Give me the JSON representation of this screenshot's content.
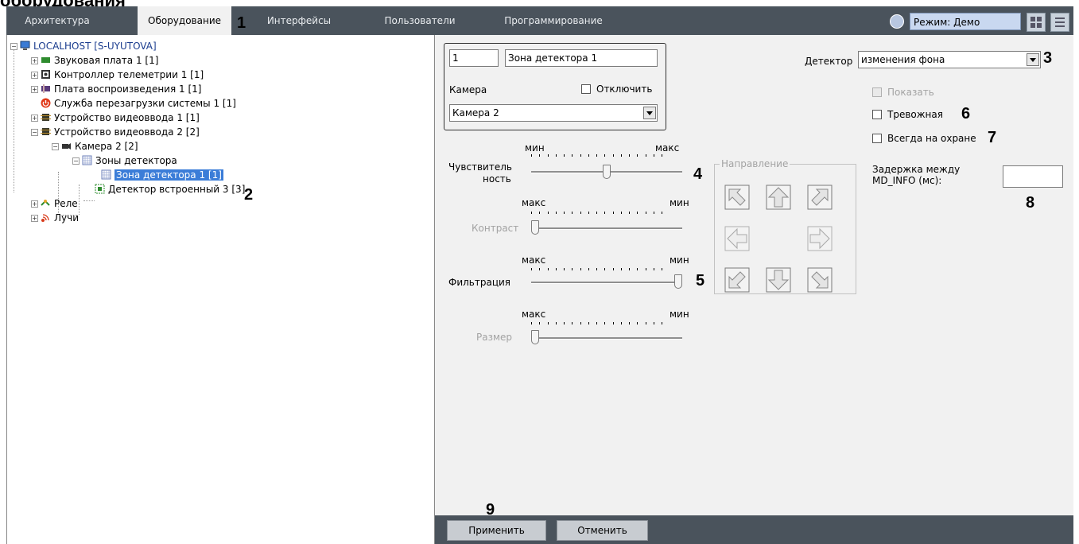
{
  "page_heading_fragment": "оборудования",
  "tabs": [
    "Архитектура",
    "Оборудование",
    "Интерфейсы",
    "Пользователи",
    "Программирование"
  ],
  "mode": {
    "value": "Режим: Демо"
  },
  "tree": {
    "root": "LOCALHOST [S-UYUTOVA]",
    "items": [
      "Звуковая плата 1 [1]",
      "Контроллер телеметрии 1 [1]",
      "Плата воспроизведения 1 [1]",
      "Служба перезагрузки системы 1 [1]",
      "Устройство видеоввода 1 [1]",
      "Устройство видеоввода 2 [2]",
      "Камера 2 [2]",
      "Зоны детектора",
      "Зона детектора 1 [1]",
      "Детектор встроенный 3 [3]",
      "Реле",
      "Лучи"
    ]
  },
  "settings": {
    "id_value": "1",
    "name_value": "Зона детектора 1",
    "camera_label": "Камера",
    "disable_label": "Отключить",
    "camera_value": "Камера 2",
    "detector_label": "Детектор",
    "detector_value": "изменения фона",
    "show_label": "Показать",
    "alarm_label": "Тревожная",
    "always_armed_label": "Всегда на охране",
    "delay_label_line1": "Задержка между",
    "delay_label_line2": "MD_INFO (мс):",
    "delay_value": "",
    "sensitivity_label_line1": "Чувствитель",
    "sensitivity_label_line2": "ность",
    "sensitivity_min": "мин",
    "sensitivity_max": "макс",
    "contrast_label": "Контраст",
    "contrast_left": "макс",
    "contrast_right": "мин",
    "filter_label": "Фильтрация",
    "filter_left": "макс",
    "filter_right": "мин",
    "size_label": "Размер",
    "size_left": "макс",
    "size_right": "мин",
    "direction_legend": "Направление",
    "apply_label": "Применить",
    "cancel_label": "Отменить"
  },
  "sliders": {
    "sensitivity": 0.5,
    "contrast": 0.0,
    "filter": 1.0,
    "size": 0.0
  },
  "callouts": [
    "1",
    "2",
    "3",
    "4",
    "5",
    "6",
    "7",
    "8",
    "9"
  ],
  "colors": {
    "tabbar": "#4a535c",
    "panel": "#f1f1f1",
    "selection": "#3b7dd8",
    "mode_field": "#c9d8f0"
  }
}
